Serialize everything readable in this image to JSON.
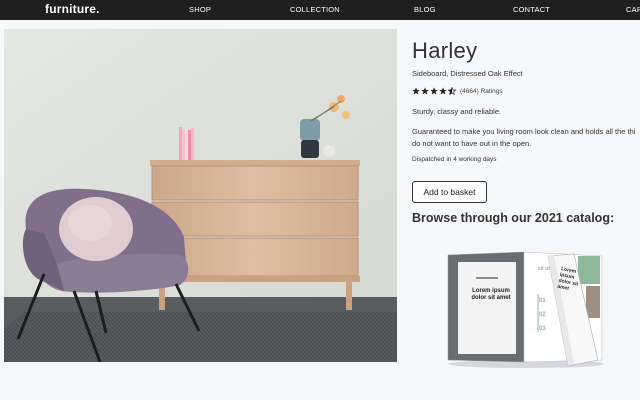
{
  "nav": {
    "brand": "furniture",
    "brand_dot": ".",
    "links": [
      "SHOP",
      "COLLECTION",
      "BLOG",
      "CONTACT",
      "CART"
    ]
  },
  "product": {
    "image_alt": "Lilac velvet armchair beside oak sideboard",
    "title": "Harley",
    "subtitle": "Sideboard, Distressed Oak Effect",
    "rating": 4.5,
    "rating_count": "(4664) Ratings",
    "tagline": "Sturdy, classy and reliable.",
    "description_line1": "Guaranteed to make you living room look clean and holds all the thi",
    "description_line2": "do not want to have out in the open.",
    "dispatch": "Dispatched in 4 working days",
    "add_to_basket": "Add to basket"
  },
  "catalog": {
    "heading": "Browse through our 2021 catalog:",
    "page_headline": "Lorem ipsum dolor sit amet",
    "side_headline": "sit ut",
    "flip_headline": "Lorem ipsum dolor sit amet",
    "numbers": [
      "01",
      "02",
      "03"
    ]
  },
  "colors": {
    "nav_bg": "#1f1f1f",
    "page_bg": "#f7f8fa",
    "wall": "#dfe3dc",
    "oak": "#d9b79a",
    "lilac": "#8a7a93",
    "rug": "#4a4d52",
    "accent_green": "#8fb79a"
  }
}
